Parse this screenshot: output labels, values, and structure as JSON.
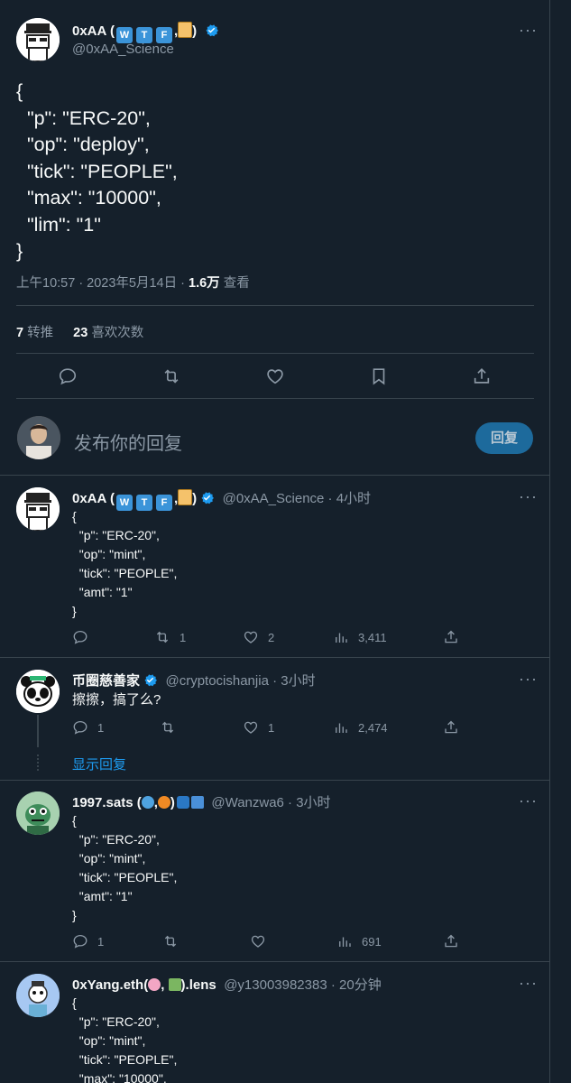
{
  "main_tweet": {
    "author_name": "0xAA",
    "badges": [
      "W",
      "T",
      "F"
    ],
    "handle": "@0xAA_Science",
    "content": "{\n  \"p\": \"ERC-20\",\n  \"op\": \"deploy\",\n  \"tick\": \"PEOPLE\",\n  \"max\": \"10000\",\n  \"lim\": \"1\"\n}",
    "time": "上午10:57 · 2023年5月14日 · ",
    "views_count": "1.6万",
    "views_label": " 查看",
    "retweets_count": "7",
    "retweets_label": "转推",
    "likes_count": "23",
    "likes_label": "喜欢次数"
  },
  "reply_composer": {
    "placeholder": "发布你的回复",
    "button_label": "回复"
  },
  "replies": [
    {
      "author_name": "0xAA",
      "badges": [
        "W",
        "T",
        "F"
      ],
      "handle": "@0xAA_Science · 4小时",
      "content": "{\n  \"p\": \"ERC-20\",\n  \"op\": \"mint\",\n  \"tick\": \"PEOPLE\",\n  \"amt\": \"1\"\n}",
      "reply_count": "",
      "retweet_count": "1",
      "like_count": "2",
      "views": "3,411"
    },
    {
      "author_name": "币圈慈善家",
      "handle": "@cryptocishanjia · 3小时",
      "content": "擦擦，搞了么?",
      "reply_count": "1",
      "retweet_count": "",
      "like_count": "1",
      "views": "2,474",
      "show_replies": "显示回复"
    },
    {
      "author_name": "1997.sats (",
      "author_name_suffix": ")",
      "handle": "@Wanzwa6 · 3小时",
      "content": "{\n  \"p\": \"ERC-20\",\n  \"op\": \"mint\",\n  \"tick\": \"PEOPLE\",\n  \"amt\": \"1\"\n}",
      "reply_count": "1",
      "retweet_count": "",
      "like_count": "",
      "views": "691"
    },
    {
      "author_name": "0xYang.eth(",
      "author_name_suffix": ").lens",
      "handle": "@y13003982383 · 20分钟",
      "content": "{\n  \"p\": \"ERC-20\",\n  \"op\": \"mint\",\n  \"tick\": \"PEOPLE\",\n  \"max\": \"10000\","
    }
  ],
  "colors": {
    "background": "#15202b",
    "accent": "#1d9bf0",
    "secondary_text": "#8b98a5",
    "border": "#38444d"
  }
}
